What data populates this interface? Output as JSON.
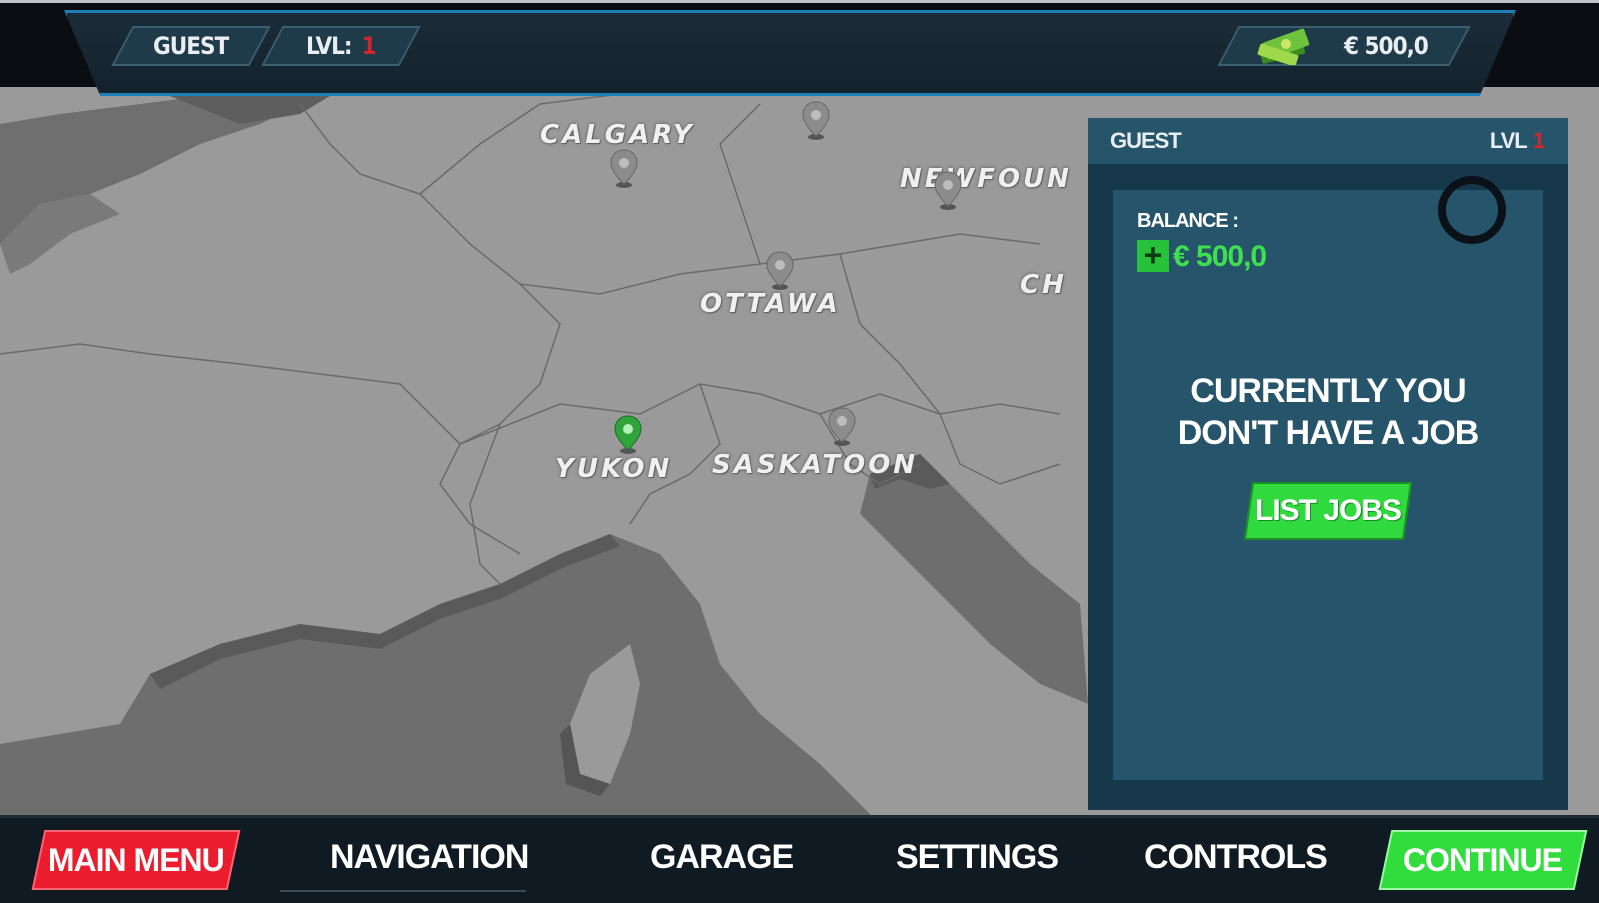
{
  "header": {
    "player_name": "GUEST",
    "level_label": "LVL:",
    "level_value": "1",
    "money": "€ 500,0",
    "money_icon": "cash-stack-icon"
  },
  "map": {
    "cities": [
      "CALGARY",
      "NEWFOUN",
      "OTTAWA",
      "CH",
      "YUKON",
      "SASKATOON"
    ],
    "selected_city": "YUKON"
  },
  "panel": {
    "player_name": "GUEST",
    "level_label": "LVL",
    "level_value": "1",
    "balance_label": "BALANCE :",
    "balance_plus": "+",
    "balance_value": "€ 500,0",
    "message_line1": "CURRENTLY YOU",
    "message_line2": "DON'T HAVE A JOB",
    "list_jobs_label": "LIST JOBS"
  },
  "bottom_nav": {
    "main_menu": "MAIN MENU",
    "navigation": "NAVIGATION",
    "garage": "GARAGE",
    "settings": "SETTINGS",
    "controls": "CONTROLS",
    "continue": "CONTINUE"
  },
  "colors": {
    "accent_blue": "#1e7fb8",
    "accent_red": "#ea1c2e",
    "accent_green": "#31dc3d",
    "panel_bg": "#16384a",
    "map_land": "#9a9a9a",
    "map_sea": "#6a6a6a"
  }
}
